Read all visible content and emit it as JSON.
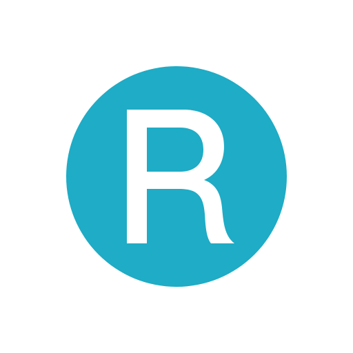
{
  "app_icon": {
    "letter": "R",
    "icon": "letter-r-logo-icon",
    "colors": {
      "circle": "#1eacc6",
      "letter": "#ffffff",
      "background": "#ffffff"
    }
  }
}
